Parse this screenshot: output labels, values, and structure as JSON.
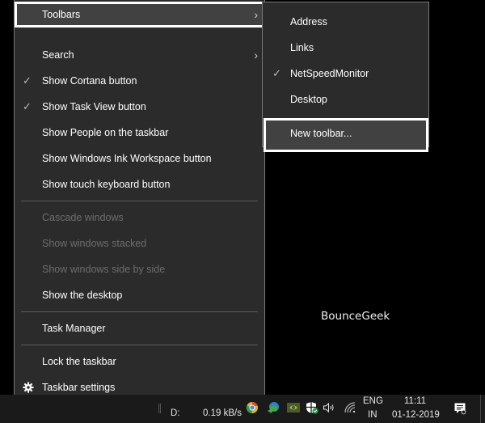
{
  "context_menu": {
    "items": [
      {
        "label": "Toolbars",
        "checked": false,
        "disabled": false,
        "submenu": true,
        "highlighted": true
      },
      {
        "label": "Search",
        "checked": false,
        "disabled": false,
        "submenu": true
      },
      {
        "label": "Show Cortana button",
        "checked": true,
        "disabled": false
      },
      {
        "label": "Show Task View button",
        "checked": true,
        "disabled": false
      },
      {
        "label": "Show People on the taskbar",
        "checked": false,
        "disabled": false
      },
      {
        "label": "Show Windows Ink Workspace button",
        "checked": false,
        "disabled": false
      },
      {
        "label": "Show touch keyboard button",
        "checked": false,
        "disabled": false
      },
      {
        "label": "Cascade windows",
        "checked": false,
        "disabled": true
      },
      {
        "label": "Show windows stacked",
        "checked": false,
        "disabled": true
      },
      {
        "label": "Show windows side by side",
        "checked": false,
        "disabled": true
      },
      {
        "label": "Show the desktop",
        "checked": false,
        "disabled": false
      },
      {
        "label": "Task Manager",
        "checked": false,
        "disabled": false
      },
      {
        "label": "Lock the taskbar",
        "checked": false,
        "disabled": false
      },
      {
        "label": "Taskbar settings",
        "checked": false,
        "disabled": false,
        "icon": "gear-icon"
      }
    ],
    "check_glyph": "✓",
    "arrow_glyph": "›"
  },
  "toolbars_submenu": {
    "items": [
      {
        "label": "Address",
        "checked": false
      },
      {
        "label": "Links",
        "checked": false
      },
      {
        "label": "NetSpeedMonitor",
        "checked": true
      },
      {
        "label": "Desktop",
        "checked": false
      },
      {
        "label": "New toolbar...",
        "checked": false,
        "highlighted": true
      }
    ]
  },
  "watermark": "BounceGeek",
  "taskbar": {
    "netspeed_drive": "D:",
    "netspeed_value": "0.19 kB/s",
    "tray_icons": [
      "chrome-icon",
      "network-globe-icon",
      "nvidia-icon",
      "windows-security-icon",
      "volume-icon",
      "wifi-icon"
    ],
    "language": "ENG",
    "region": "IN",
    "time": "11:11",
    "date": "01-12-2019",
    "notification_icon": "action-center-icon"
  },
  "colors": {
    "menu_bg": "#2b2b2b",
    "highlight_bg": "#414141",
    "disabled_text": "#6d6d6d",
    "taskbar_bg": "#1a1a1a"
  }
}
